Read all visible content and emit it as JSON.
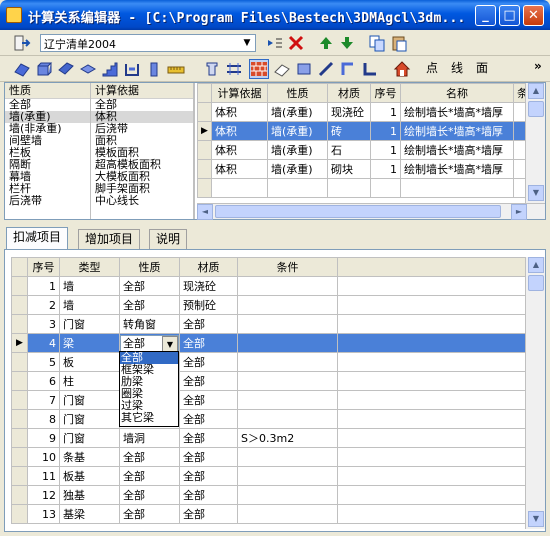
{
  "window": {
    "title": "计算关系编辑器 - [C:\\Program Files\\Bestech\\3DMAgcl\\3dm...",
    "buttons": {
      "minimize": "_",
      "maximize": "□",
      "close": "✕"
    }
  },
  "toolbar": {
    "combo_value": "辽宁清单2004",
    "text_buttons": [
      "点",
      "线",
      "面"
    ],
    "overflow": "»"
  },
  "property_list": {
    "header": "性质",
    "items": [
      "全部",
      "墙(承重)",
      "墙(非承重)",
      "间壁墙",
      "栏板",
      "隔断",
      "幕墙",
      "栏杆",
      "后浇带"
    ],
    "selected_index": 1
  },
  "basis_list": {
    "header": "计算依据",
    "items": [
      "全部",
      "体积",
      "后浇带",
      "面积",
      "模板面积",
      "超高模板面积",
      "大模板面积",
      "脚手架面积",
      "中心线长"
    ],
    "selected_index": 1
  },
  "rule_table": {
    "headers": [
      "计算依据",
      "性质",
      "材质",
      "序号",
      "名称",
      "条件"
    ],
    "rows": [
      [
        "体积",
        "墙(承重)",
        "现浇砼",
        "1",
        "绘制墙长*墙高*墙厚",
        ""
      ],
      [
        "体积",
        "墙(承重)",
        "砖",
        "1",
        "绘制墙长*墙高*墙厚",
        ""
      ],
      [
        "体积",
        "墙(承重)",
        "石",
        "1",
        "绘制墙长*墙高*墙厚",
        ""
      ],
      [
        "体积",
        "墙(承重)",
        "砌块",
        "1",
        "绘制墙长*墙高*墙厚",
        ""
      ]
    ],
    "selected_index": 1
  },
  "tabs": [
    "扣减项目",
    "增加项目",
    "说明"
  ],
  "active_tab": 0,
  "deduct_table": {
    "headers": [
      "序号",
      "类型",
      "性质",
      "材质",
      "条件"
    ],
    "rows": [
      [
        "1",
        "墙",
        "全部",
        "现浇砼",
        ""
      ],
      [
        "2",
        "墙",
        "全部",
        "预制砼",
        ""
      ],
      [
        "3",
        "门窗",
        "转角窗",
        "全部",
        ""
      ],
      [
        "4",
        "梁",
        "全部",
        "全部",
        ""
      ],
      [
        "5",
        "板",
        "",
        "全部",
        ""
      ],
      [
        "6",
        "柱",
        "",
        "全部",
        ""
      ],
      [
        "7",
        "门窗",
        "",
        "全部",
        ""
      ],
      [
        "8",
        "门窗",
        "",
        "全部",
        ""
      ],
      [
        "9",
        "门窗",
        "墙洞",
        "全部",
        "S＞0.3m2"
      ],
      [
        "10",
        "条基",
        "全部",
        "全部",
        ""
      ],
      [
        "11",
        "板基",
        "全部",
        "全部",
        ""
      ],
      [
        "12",
        "独基",
        "全部",
        "全部",
        ""
      ],
      [
        "13",
        "基梁",
        "全部",
        "全部",
        ""
      ]
    ],
    "selected_index": 3
  },
  "dropdown": {
    "current": "全部",
    "options": [
      "全部",
      "框架梁",
      "肋梁",
      "圈梁",
      "过梁",
      "其它梁"
    ],
    "highlighted_index": 0
  },
  "colors": {
    "title_bar": "#0058e0",
    "selection": "#4a80d8",
    "chrome": "#ece9d8"
  }
}
